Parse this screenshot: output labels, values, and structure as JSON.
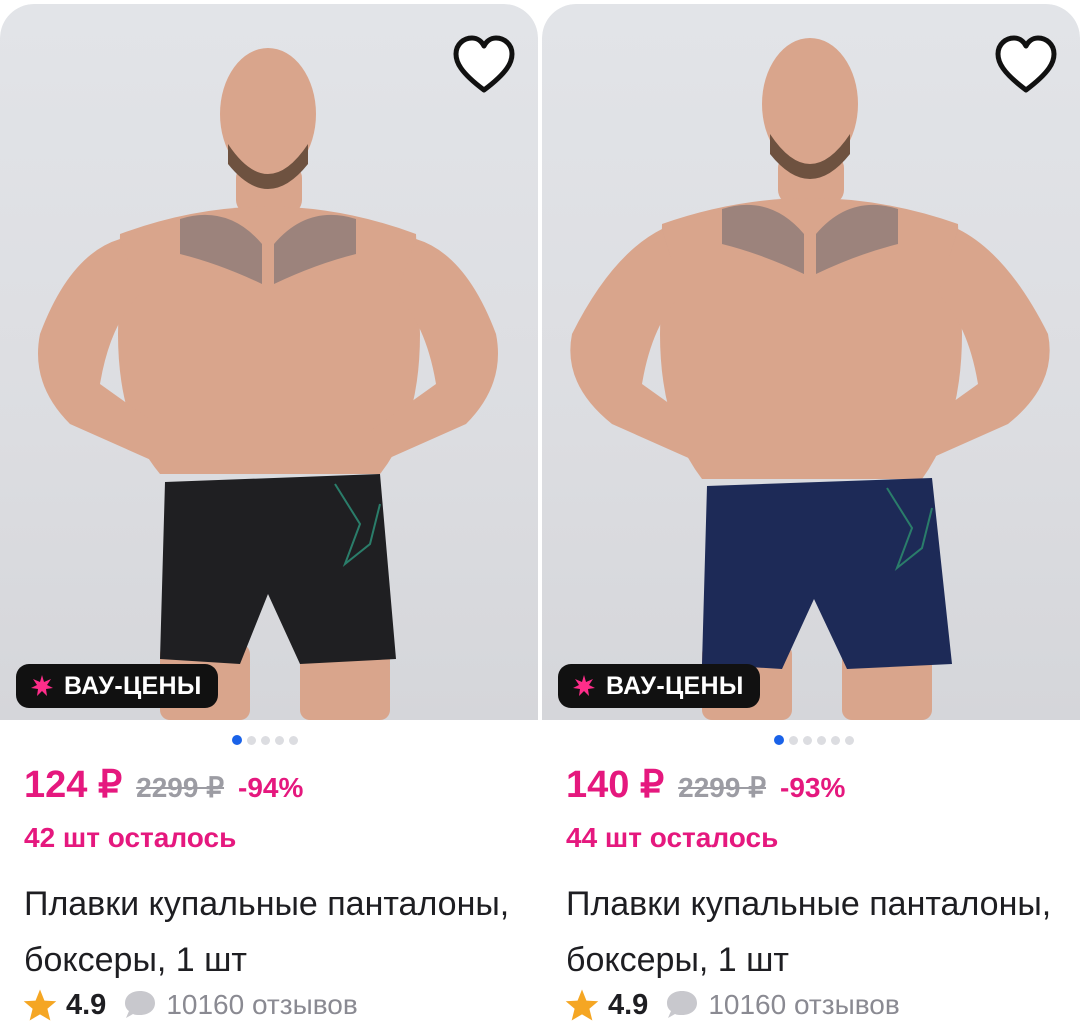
{
  "colors": {
    "accent": "#e5187e",
    "badge_bg": "#111111",
    "dot_active": "#1a62e8",
    "old_price": "#9c9ca3",
    "star": "#f5a623"
  },
  "cards": [
    {
      "badge": "ВАУ-ЦЕНЫ",
      "price": "124 ₽",
      "old_price": "2299 ₽",
      "discount": "-94%",
      "stock": "42 шт осталось",
      "title": "Плавки купальные панталоны, боксеры, 1 шт",
      "rating": "4.9",
      "reviews": "10160 отзывов",
      "gallery_index": 1,
      "gallery_count": 5,
      "shorts_color": "#1f1f22",
      "icons": [
        "heart-icon",
        "wow-star-icon",
        "star-icon",
        "chat-bubble-icon"
      ]
    },
    {
      "badge": "ВАУ-ЦЕНЫ",
      "price": "140 ₽",
      "old_price": "2299 ₽",
      "discount": "-93%",
      "stock": "44 шт осталось",
      "title": "Плавки купальные панталоны, боксеры, 1 шт",
      "rating": "4.9",
      "reviews": "10160 отзывов",
      "gallery_index": 1,
      "gallery_count": 6,
      "shorts_color": "#1d2a57",
      "icons": [
        "heart-icon",
        "wow-star-icon",
        "star-icon",
        "chat-bubble-icon"
      ]
    }
  ]
}
